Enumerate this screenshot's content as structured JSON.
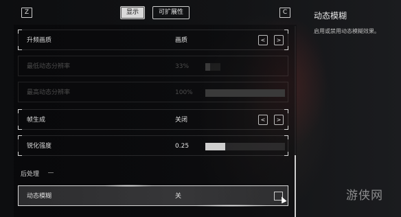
{
  "header": {
    "left_key": "Z",
    "right_key": "C",
    "tabs": [
      {
        "label": "显示",
        "active": true
      },
      {
        "label": "可扩展性",
        "active": false
      }
    ]
  },
  "settings": {
    "upscale": {
      "label": "升频画质",
      "value": "画质",
      "prev": "<",
      "next": ">"
    },
    "min_res": {
      "label": "最低动态分辨率",
      "value": "33%",
      "fill_percent": 33,
      "enabled": false
    },
    "max_res": {
      "label": "最高动态分辨率",
      "value": "100%",
      "fill_percent": 100,
      "enabled": false
    },
    "frame_gen": {
      "label": "帧生成",
      "value": "关闭",
      "prev": "<",
      "next": ">"
    },
    "sharpen": {
      "label": "锐化强度",
      "value": "0.25",
      "fill_percent": 25
    }
  },
  "section": {
    "post_processing": "后处理"
  },
  "motion_blur": {
    "label": "动态模糊",
    "value": "关",
    "checked": false
  },
  "detail": {
    "title": "动态模糊",
    "description": "启用或禁用动态模糊效果。"
  },
  "watermark": "游侠网",
  "colors": {
    "accent": "#d9d9d9",
    "background": "#0f1012"
  }
}
